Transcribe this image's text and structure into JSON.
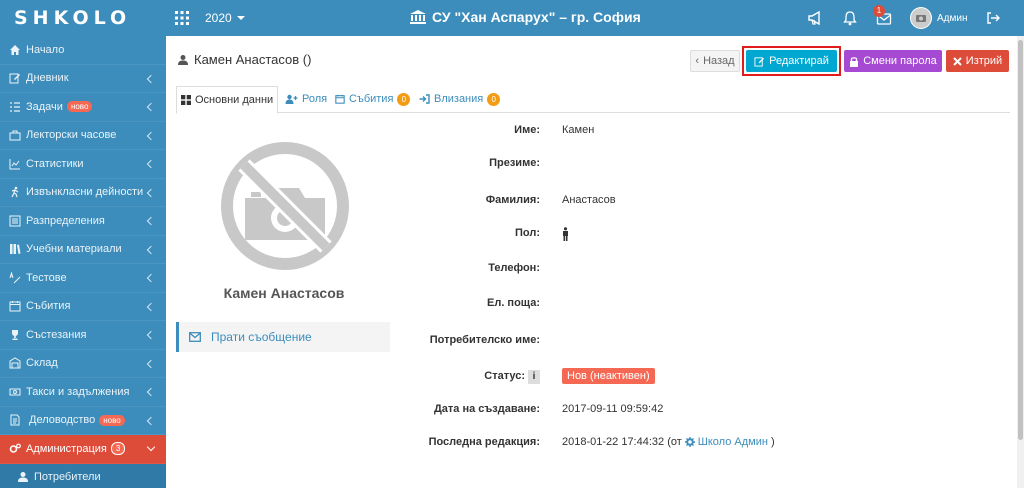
{
  "topbar": {
    "logo": "SHKOLO",
    "year": "2020",
    "school": "СУ \"Хан Аспарух\" – гр. София",
    "notifications_count": "1",
    "user": "Админ"
  },
  "sidebar": {
    "items": [
      {
        "label": "Начало",
        "icon": "home-icon",
        "chevron": false
      },
      {
        "label": "Дневник",
        "icon": "edit-icon",
        "chevron": true
      },
      {
        "label": "Задачи",
        "icon": "tasks-icon",
        "badge": "ново",
        "chevron": true
      },
      {
        "label": "Лекторски часове",
        "icon": "suitcase-icon",
        "chevron": true
      },
      {
        "label": "Статистики",
        "icon": "chart-icon",
        "chevron": true
      },
      {
        "label": "Извънкласни дейности",
        "icon": "running-icon",
        "chevron": true
      },
      {
        "label": "Разпределения",
        "icon": "list-icon",
        "chevron": true
      },
      {
        "label": "Учебни материали",
        "icon": "books-icon",
        "chevron": true
      },
      {
        "label": "Тестове",
        "icon": "abc-icon",
        "chevron": true
      },
      {
        "label": "Събития",
        "icon": "calendar-icon",
        "chevron": true
      },
      {
        "label": "Състезания",
        "icon": "trophy-icon",
        "chevron": true
      },
      {
        "label": "Склад",
        "icon": "warehouse-icon",
        "chevron": true
      },
      {
        "label": "Такси и задължения",
        "icon": "money-icon",
        "chevron": true
      },
      {
        "label": "Деловодство",
        "icon": "document-icon",
        "badge": "ново",
        "chevron": true
      },
      {
        "label": "Администрация",
        "icon": "cogs-icon",
        "count": "3",
        "chevron": true,
        "active": true
      },
      {
        "label": "Потребители",
        "icon": "user-icon",
        "chevron": false,
        "sub": true
      }
    ]
  },
  "header": {
    "title": "Камен Анастасов ()",
    "back": "Назад",
    "edit": "Редактирай",
    "change_password": "Смени парола",
    "delete": "Изтрий"
  },
  "tabs": [
    {
      "label": "Основни данни",
      "active": true
    },
    {
      "label": "Роля"
    },
    {
      "label": "Събития",
      "badge": "0"
    },
    {
      "label": "Влизания",
      "badge": "0"
    }
  ],
  "profile": {
    "name": "Камен Анастасов",
    "send_message": "Прати съобщение"
  },
  "details": {
    "first_name_label": "Име:",
    "first_name": "Камен",
    "middle_name_label": "Презиме:",
    "middle_name": "",
    "last_name_label": "Фамилия:",
    "last_name": "Анастасов",
    "gender_label": "Пол:",
    "phone_label": "Телефон:",
    "phone": "",
    "email_label": "Ел. поща:",
    "email": "",
    "username_label": "Потребителско име:",
    "username": "",
    "status_label": "Статус:",
    "status": "Нов (неактивен)",
    "status_info": "i",
    "created_label": "Дата на създаване:",
    "created": "2017-09-11 09:59:42",
    "updated_label": "Последна редакция:",
    "updated": "2018-01-22 17:44:32 (от",
    "updated_by": "Школо Админ",
    "updated_close": ")"
  },
  "colors": {
    "primary": "#3c8dbc",
    "danger": "#dd4b39",
    "info": "#00a7d0",
    "purple": "#a64ad4",
    "warning": "#f39c12"
  }
}
